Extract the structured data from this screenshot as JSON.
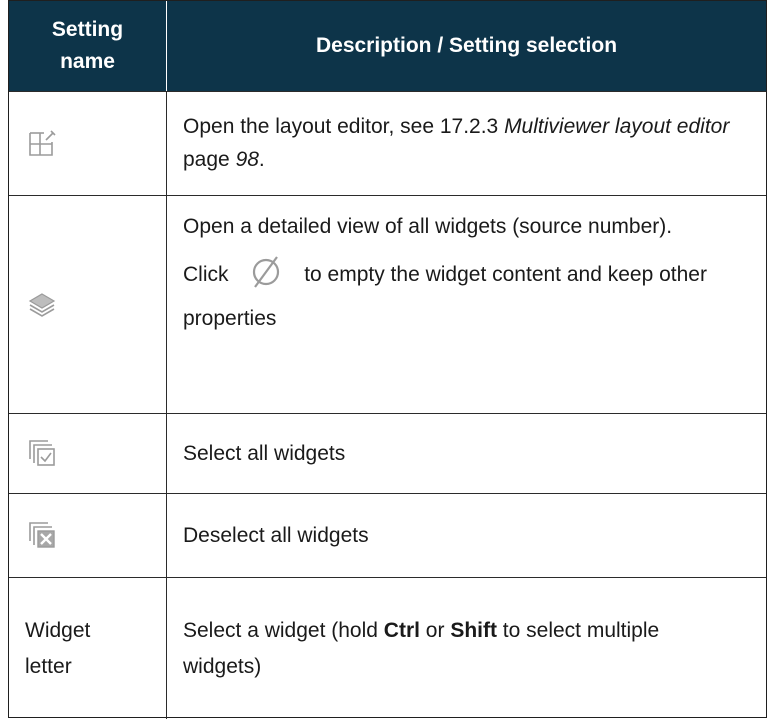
{
  "table": {
    "header": {
      "col1": "Setting name",
      "col2": "Description / Setting selection"
    },
    "rows": [
      {
        "icon": "layout-editor-icon",
        "desc_prefix": "Open the layout editor, see 17.2.3 ",
        "desc_link": "Multiviewer layout editor",
        "desc_mid": " page ",
        "desc_page": "98",
        "desc_suffix": "."
      },
      {
        "icon": "layers-icon",
        "desc_line1": "Open a detailed view of all widgets (source number).",
        "desc_click": "Click",
        "desc_click_icon": "empty-set-icon",
        "desc_click_rest": "to empty the widget content and keep other properties"
      },
      {
        "icon": "select-all-icon",
        "desc": "Select all widgets"
      },
      {
        "icon": "deselect-all-icon",
        "desc": "Deselect all widgets"
      },
      {
        "name": "Widget letter",
        "desc_prefix": "Select a widget (hold ",
        "desc_key1": "Ctrl",
        "desc_or": " or ",
        "desc_key2": "Shift",
        "desc_suffix": " to select multiple widgets)"
      }
    ]
  },
  "colors": {
    "header_bg": "#0d3449",
    "header_text": "#ffffff",
    "icon_gray": "#9b9b9b"
  }
}
